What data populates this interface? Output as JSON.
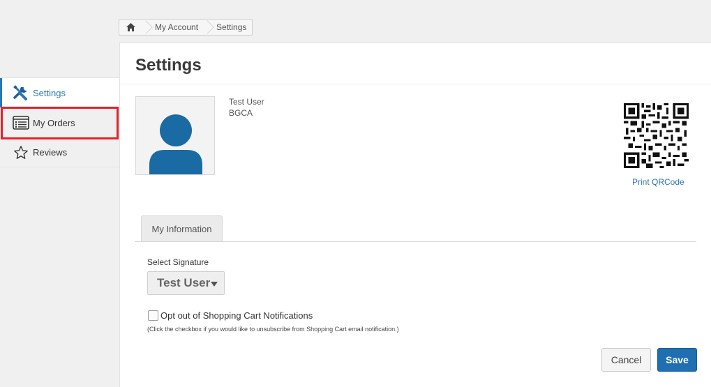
{
  "breadcrumb": {
    "home_icon": "home-icon",
    "items": [
      "My Account",
      "Settings"
    ]
  },
  "sidebar": {
    "items": [
      {
        "label": "Settings",
        "icon": "tools-icon",
        "active": true
      },
      {
        "label": "My Orders",
        "icon": "orders-list-icon",
        "active": false
      },
      {
        "label": "Reviews",
        "icon": "star-icon",
        "active": false
      }
    ],
    "highlight_color": "#e3202a"
  },
  "main": {
    "title": "Settings",
    "user": {
      "name": "Test User",
      "org": "BGCA",
      "avatar_icon": "user-avatar-icon"
    },
    "qr": {
      "icon": "qr-code-icon",
      "link_label": "Print QRCode"
    },
    "tabs": [
      {
        "label": "My Information",
        "active": true
      }
    ],
    "signature": {
      "label": "Select Signature",
      "selected": "Test User"
    },
    "opt_out": {
      "label": "Opt out of Shopping Cart Notifications",
      "checked": false,
      "help": "(Click the checkbox if you would like to unsubscribe from Shopping Cart email notification.)"
    },
    "buttons": {
      "cancel": "Cancel",
      "save": "Save"
    }
  },
  "colors": {
    "accent": "#2a77b8",
    "save_button": "#1f6fb2",
    "avatar": "#1a6ba3"
  }
}
